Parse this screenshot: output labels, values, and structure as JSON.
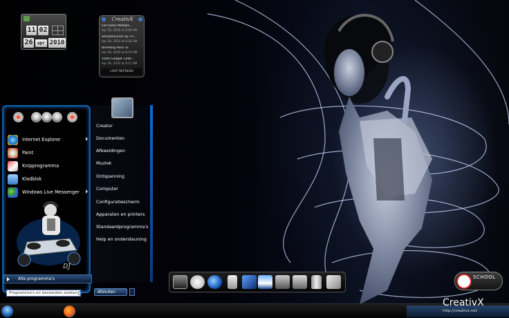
{
  "clock": {
    "hour": "11",
    "minute": "02",
    "day": "26",
    "month": "apr",
    "year": "2010"
  },
  "feed": {
    "logo": "CreativX",
    "items": [
      {
        "title": "Full Glass Notepa...",
        "date": "Apr 26, 2010 at 8:49 AM"
      },
      {
        "title": "SmoothGaTan by Th...",
        "date": "Apr 26, 2010 at 8:28 AM"
      },
      {
        "title": "Bleeding Aero v1",
        "date": "Apr 26, 2010 at 8:19 AM"
      },
      {
        "title": "1000 Gadget Colle...",
        "date": "Apr 26, 2010 at 8:11 AM"
      }
    ],
    "refresh_label": "LAST REFRESH"
  },
  "start_menu": {
    "pinned": [
      {
        "label": "Internet Explorer",
        "icon": "internet-explorer-icon",
        "has_arrow": true
      },
      {
        "label": "Paint",
        "icon": "paint-icon",
        "has_arrow": false
      },
      {
        "label": "Knipprogramma",
        "icon": "snipping-tool-icon",
        "has_arrow": false
      },
      {
        "label": "Kladblok",
        "icon": "notepad-icon",
        "has_arrow": false
      },
      {
        "label": "Windows Live Messenger",
        "icon": "messenger-icon",
        "has_arrow": true
      }
    ],
    "all_programs": "Alle programma's",
    "search_placeholder": "Programma's en bestanden zoeken",
    "shutdown": "Afsluiten",
    "places": [
      "Creator",
      "Documenten",
      "Afbeeldingen",
      "Muziek",
      "Ontspanning",
      "Computer",
      "Configuratiescherm",
      "Apparaten en printers",
      "Standaardprogramma's",
      "Help en ondersteuning"
    ]
  },
  "dock": {
    "icons": [
      "monitor-icon",
      "smiley-icon",
      "earth-icon",
      "usb-icon",
      "feather-icon",
      "paint-chart-icon",
      "box-icon",
      "gear-box-icon",
      "trash-icon",
      "tools-icon"
    ]
  },
  "gadget": {
    "label": "SCHOOL"
  },
  "watermark": {
    "brand": "CreativX",
    "url": "http://creativx.net"
  },
  "colors": {
    "accent": "#0d5fa8",
    "start_orb": "#1a5ea8",
    "background": "#020306"
  }
}
